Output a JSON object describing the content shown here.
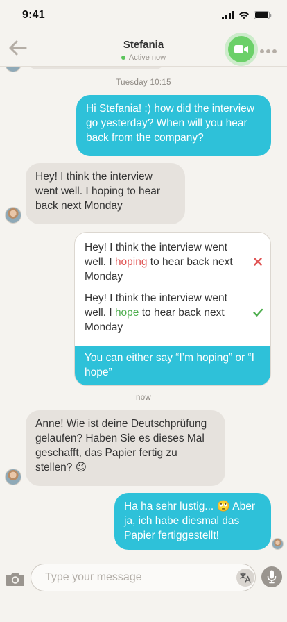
{
  "status_bar": {
    "time": "9:41"
  },
  "header": {
    "contact_name": "Stefania",
    "presence": "Active now"
  },
  "chat": {
    "timestamp_1": "Tuesday 10:15",
    "msg_out_1": "Hi Stefania! :) how did the interview go yesterday? When will you hear back from the company?",
    "msg_in_1": "Hey! I think the interview went well. I hoping to hear back next Monday",
    "correction": {
      "wrong_prefix": "Hey! I think the interview went well. I ",
      "wrong_word": "hoping",
      "wrong_suffix": " to hear back next Monday",
      "right_prefix": "Hey! I think the interview went well. I ",
      "right_word": "hope",
      "right_suffix": " to hear back next Monday",
      "tip": "You can either say “I’m hoping” or “I hope”"
    },
    "timestamp_2": "now",
    "msg_in_2": "Anne! Wie ist deine Deutschprüfung gelaufen? Haben Sie es dieses Mal geschafft, das Papier fertig zu stellen? 😉",
    "msg_out_2": "Ha ha sehr lustig... 🙄 Aber ja, ich habe diesmal das Papier fertiggestellt!"
  },
  "composer": {
    "placeholder": "Type your message",
    "value": ""
  },
  "colors": {
    "accent": "#2ec1d9",
    "online": "#5cc45c",
    "video_button": "#6bd068",
    "error": "#e05656",
    "correct": "#4eae4e"
  },
  "icons": [
    "signal-icon",
    "wifi-icon",
    "battery-icon",
    "back-arrow-icon",
    "video-camera-icon",
    "more-dots-icon",
    "cross-icon",
    "check-icon",
    "camera-icon",
    "translate-icon",
    "microphone-icon"
  ]
}
